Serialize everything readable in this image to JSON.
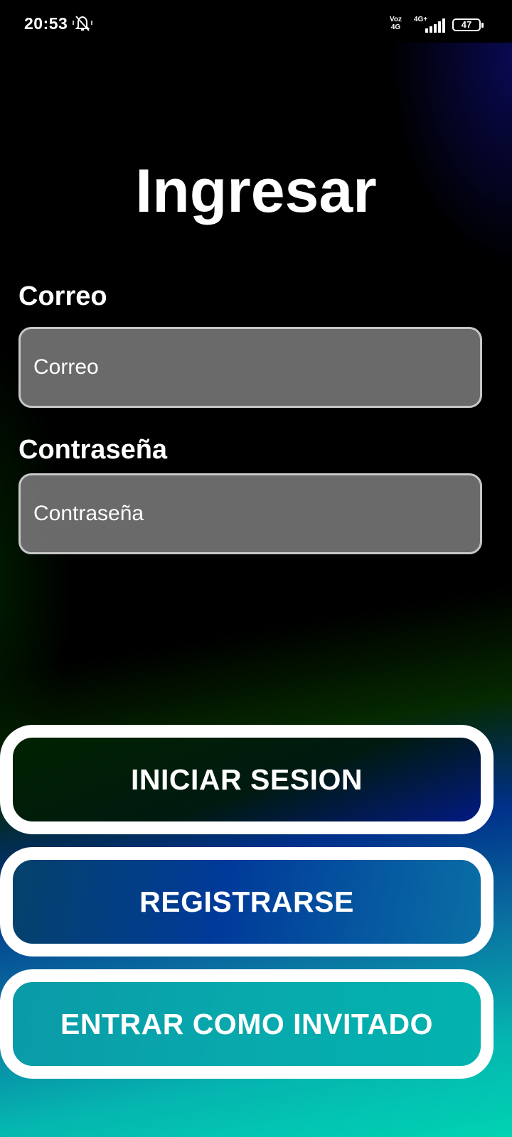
{
  "status_bar": {
    "time": "20:53",
    "network_top": "Voz",
    "network_bottom": "4G",
    "network2_top": "4G+",
    "battery": "47"
  },
  "screen": {
    "title": "Ingresar"
  },
  "form": {
    "email_label": "Correo",
    "email_placeholder": "Correo",
    "password_label": "Contraseña",
    "password_placeholder": "Contraseña"
  },
  "buttons": {
    "login": "INICIAR SESION",
    "register": "REGISTRARSE",
    "guest": "ENTRAR COMO INVITADO"
  },
  "icons": {
    "bell": "bell-muted-icon",
    "signal": "signal-bars-icon",
    "battery": "battery-icon"
  },
  "colors": {
    "field_border": "#c7c7c7",
    "button_border": "#ffffff"
  }
}
